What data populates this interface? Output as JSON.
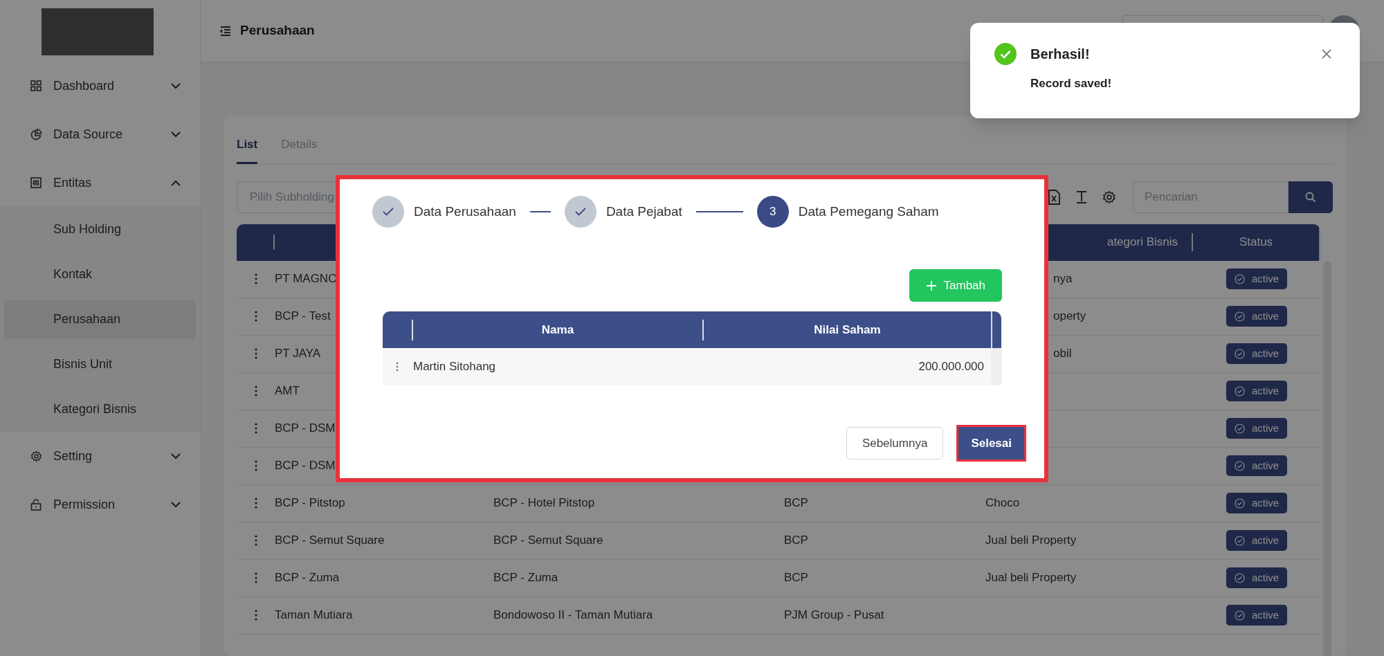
{
  "sidebar": {
    "items": [
      {
        "label": "Dashboard",
        "expanded": false
      },
      {
        "label": "Data Source",
        "expanded": false
      },
      {
        "label": "Entitas",
        "expanded": true,
        "children": [
          {
            "label": "Sub Holding",
            "selected": false
          },
          {
            "label": "Kontak",
            "selected": false
          },
          {
            "label": "Perusahaan",
            "selected": true
          },
          {
            "label": "Bisnis Unit",
            "selected": false
          },
          {
            "label": "Kategori Bisnis",
            "selected": false
          }
        ]
      },
      {
        "label": "Setting",
        "expanded": false
      },
      {
        "label": "Permission",
        "expanded": false
      }
    ]
  },
  "header": {
    "title": "Perusahaan"
  },
  "card": {
    "tabs": [
      {
        "label": "List",
        "selected": true
      },
      {
        "label": "Details",
        "selected": false
      }
    ],
    "filter": {
      "placeholder": "Pilih Subholding"
    },
    "search": {
      "placeholder": "Pencarian"
    },
    "table": {
      "header": {
        "column_4": "ategori Bisnis",
        "status": "Status"
      },
      "rows": [
        {
          "column_1": "PT MAGNO",
          "column_4": "nya",
          "status": "active"
        },
        {
          "column_1": "BCP - Test",
          "column_4": "operty",
          "status": "active"
        },
        {
          "column_1": "PT JAYA",
          "column_4": "obil",
          "status": "active"
        },
        {
          "column_1": "AMT",
          "status": "active"
        },
        {
          "column_1": "BCP - DSM",
          "status": "active"
        },
        {
          "column_1": "BCP - DSM",
          "status": "active"
        },
        {
          "column_1": "BCP - Pitstop",
          "column_2": "BCP - Hotel Pitstop",
          "column_3": "BCP",
          "column_4": "Choco",
          "status": "active"
        },
        {
          "column_1": "BCP - Semut Square",
          "column_2": "BCP - Semut Square",
          "column_3": "BCP",
          "column_4": "Jual beli Property",
          "status": "active"
        },
        {
          "column_1": "BCP - Zuma",
          "column_2": "BCP - Zuma",
          "column_3": "BCP",
          "column_4": "Jual beli Property",
          "status": "active"
        },
        {
          "column_1": "Taman Mutiara",
          "column_2": "Bondowoso II - Taman Mutiara",
          "column_3": "PJM Group - Pusat",
          "status": "active"
        }
      ]
    }
  },
  "dialog": {
    "highlighted": true,
    "steps": [
      {
        "label": "Data Perusahaan",
        "done": true
      },
      {
        "label": "Data Pejabat",
        "done": true
      },
      {
        "label": "Data Pemegang Saham",
        "done": false,
        "number": "3"
      }
    ],
    "add_button": "Tambah",
    "table": {
      "columns": [
        "Nama",
        "Nilai Saham"
      ],
      "rows": [
        {
          "nama": "Martin Sitohang",
          "nilai_saham": "200.000.000"
        }
      ]
    },
    "buttons": [
      {
        "label": "Sebelumnya",
        "kind": "secondary",
        "highlighted": false
      },
      {
        "label": "Selesai",
        "kind": "primary",
        "highlighted": true
      }
    ]
  },
  "toast": {
    "title": "Berhasil!",
    "message": "Record saved!"
  }
}
